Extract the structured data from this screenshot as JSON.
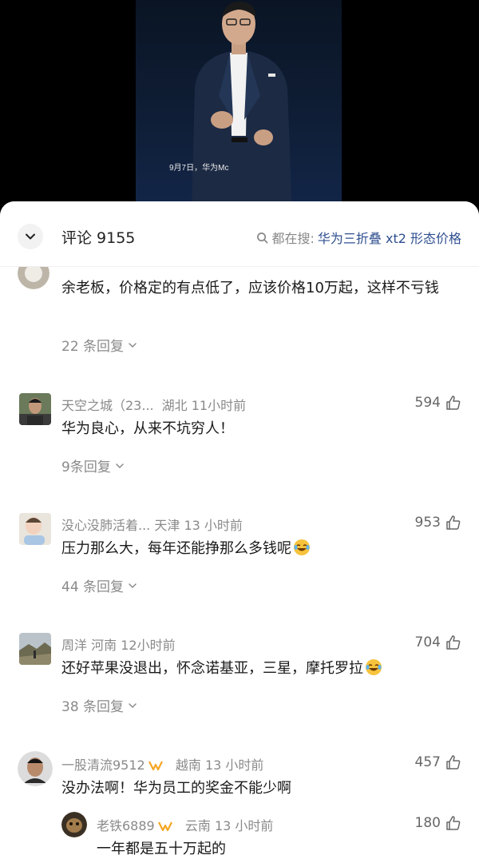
{
  "video": {
    "caption": "9月7日，华为Mc"
  },
  "header": {
    "comments_label": "评论 9155",
    "search_prefix": "都在搜:",
    "search_keyword": "华为三折叠 xt2 形态价格"
  },
  "comments": [
    {
      "text": "余老板，价格定的有点低了，应该价格10万起，这样不亏钱",
      "replies": "22 条回复"
    },
    {
      "user": "天空之城（23...",
      "location": "湖北",
      "time": "11小时前",
      "likes": "594",
      "text": "华为良心，从来不坑穷人！",
      "replies": "9条回复"
    },
    {
      "user": "没心没肺活着...",
      "location": "天津",
      "time": "13 小时前",
      "likes": "953",
      "text": "压力那么大，每年还能挣那么多钱呢",
      "emoji": "laugh-cry-emoji",
      "replies": "44 条回复"
    },
    {
      "user": "周洋",
      "location": "河南",
      "time": "12小时前",
      "likes": "704",
      "text": "还好苹果没退出，怀念诺基亚，三星，摩托罗拉",
      "emoji": "laugh-cry-emoji",
      "replies": "38 条回复"
    },
    {
      "user": "一股清流9512",
      "location": "越南",
      "time": "13 小时前",
      "likes": "457",
      "text": "没办法啊！华为员工的奖金不能少啊",
      "badge": "honor-badge-icon"
    }
  ],
  "sub_reply": {
    "user": "老铁6889",
    "location": "云南",
    "time": "13 小时前",
    "likes": "180",
    "text": "一年都是五十万起的",
    "badge": "honor-badge-icon"
  },
  "colors": {
    "keyword": "#2f4f8f",
    "meta": "#8a8a8a",
    "badge": "#f5a623"
  }
}
